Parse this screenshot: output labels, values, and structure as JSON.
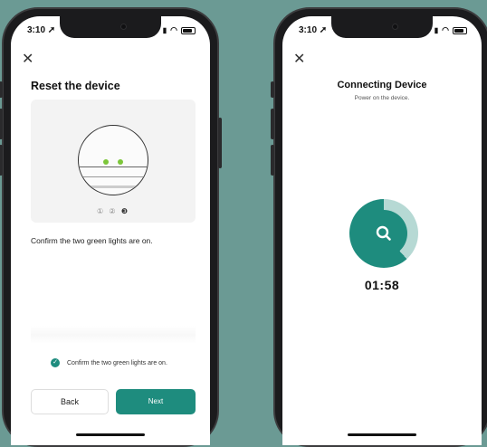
{
  "left_screen": {
    "status_time": "3:10",
    "close_glyph": "✕",
    "title": "Reset the device",
    "step_indicators": [
      "①",
      "②",
      "❸"
    ],
    "instruction": "Confirm the two green lights are on.",
    "checkbox_label": "Confirm the two green lights are on.",
    "checkbox_checked": true,
    "back_label": "Back",
    "next_label": "Next"
  },
  "right_screen": {
    "status_time": "3:10",
    "close_glyph": "✕",
    "title": "Connecting Device",
    "subtitle": "Power on the device.",
    "countdown": "01:58"
  },
  "colors": {
    "background": "#6b9a94",
    "accent": "#1e8c7e",
    "accent_light": "#b6d9d4",
    "led_green": "#7cc63a"
  },
  "icons": {
    "close": "close-icon",
    "check": "check-circle-icon",
    "search": "search-icon",
    "wifi": "wifi-icon",
    "battery": "battery-icon",
    "signal": "signal-icon",
    "location": "location-arrow-icon"
  }
}
